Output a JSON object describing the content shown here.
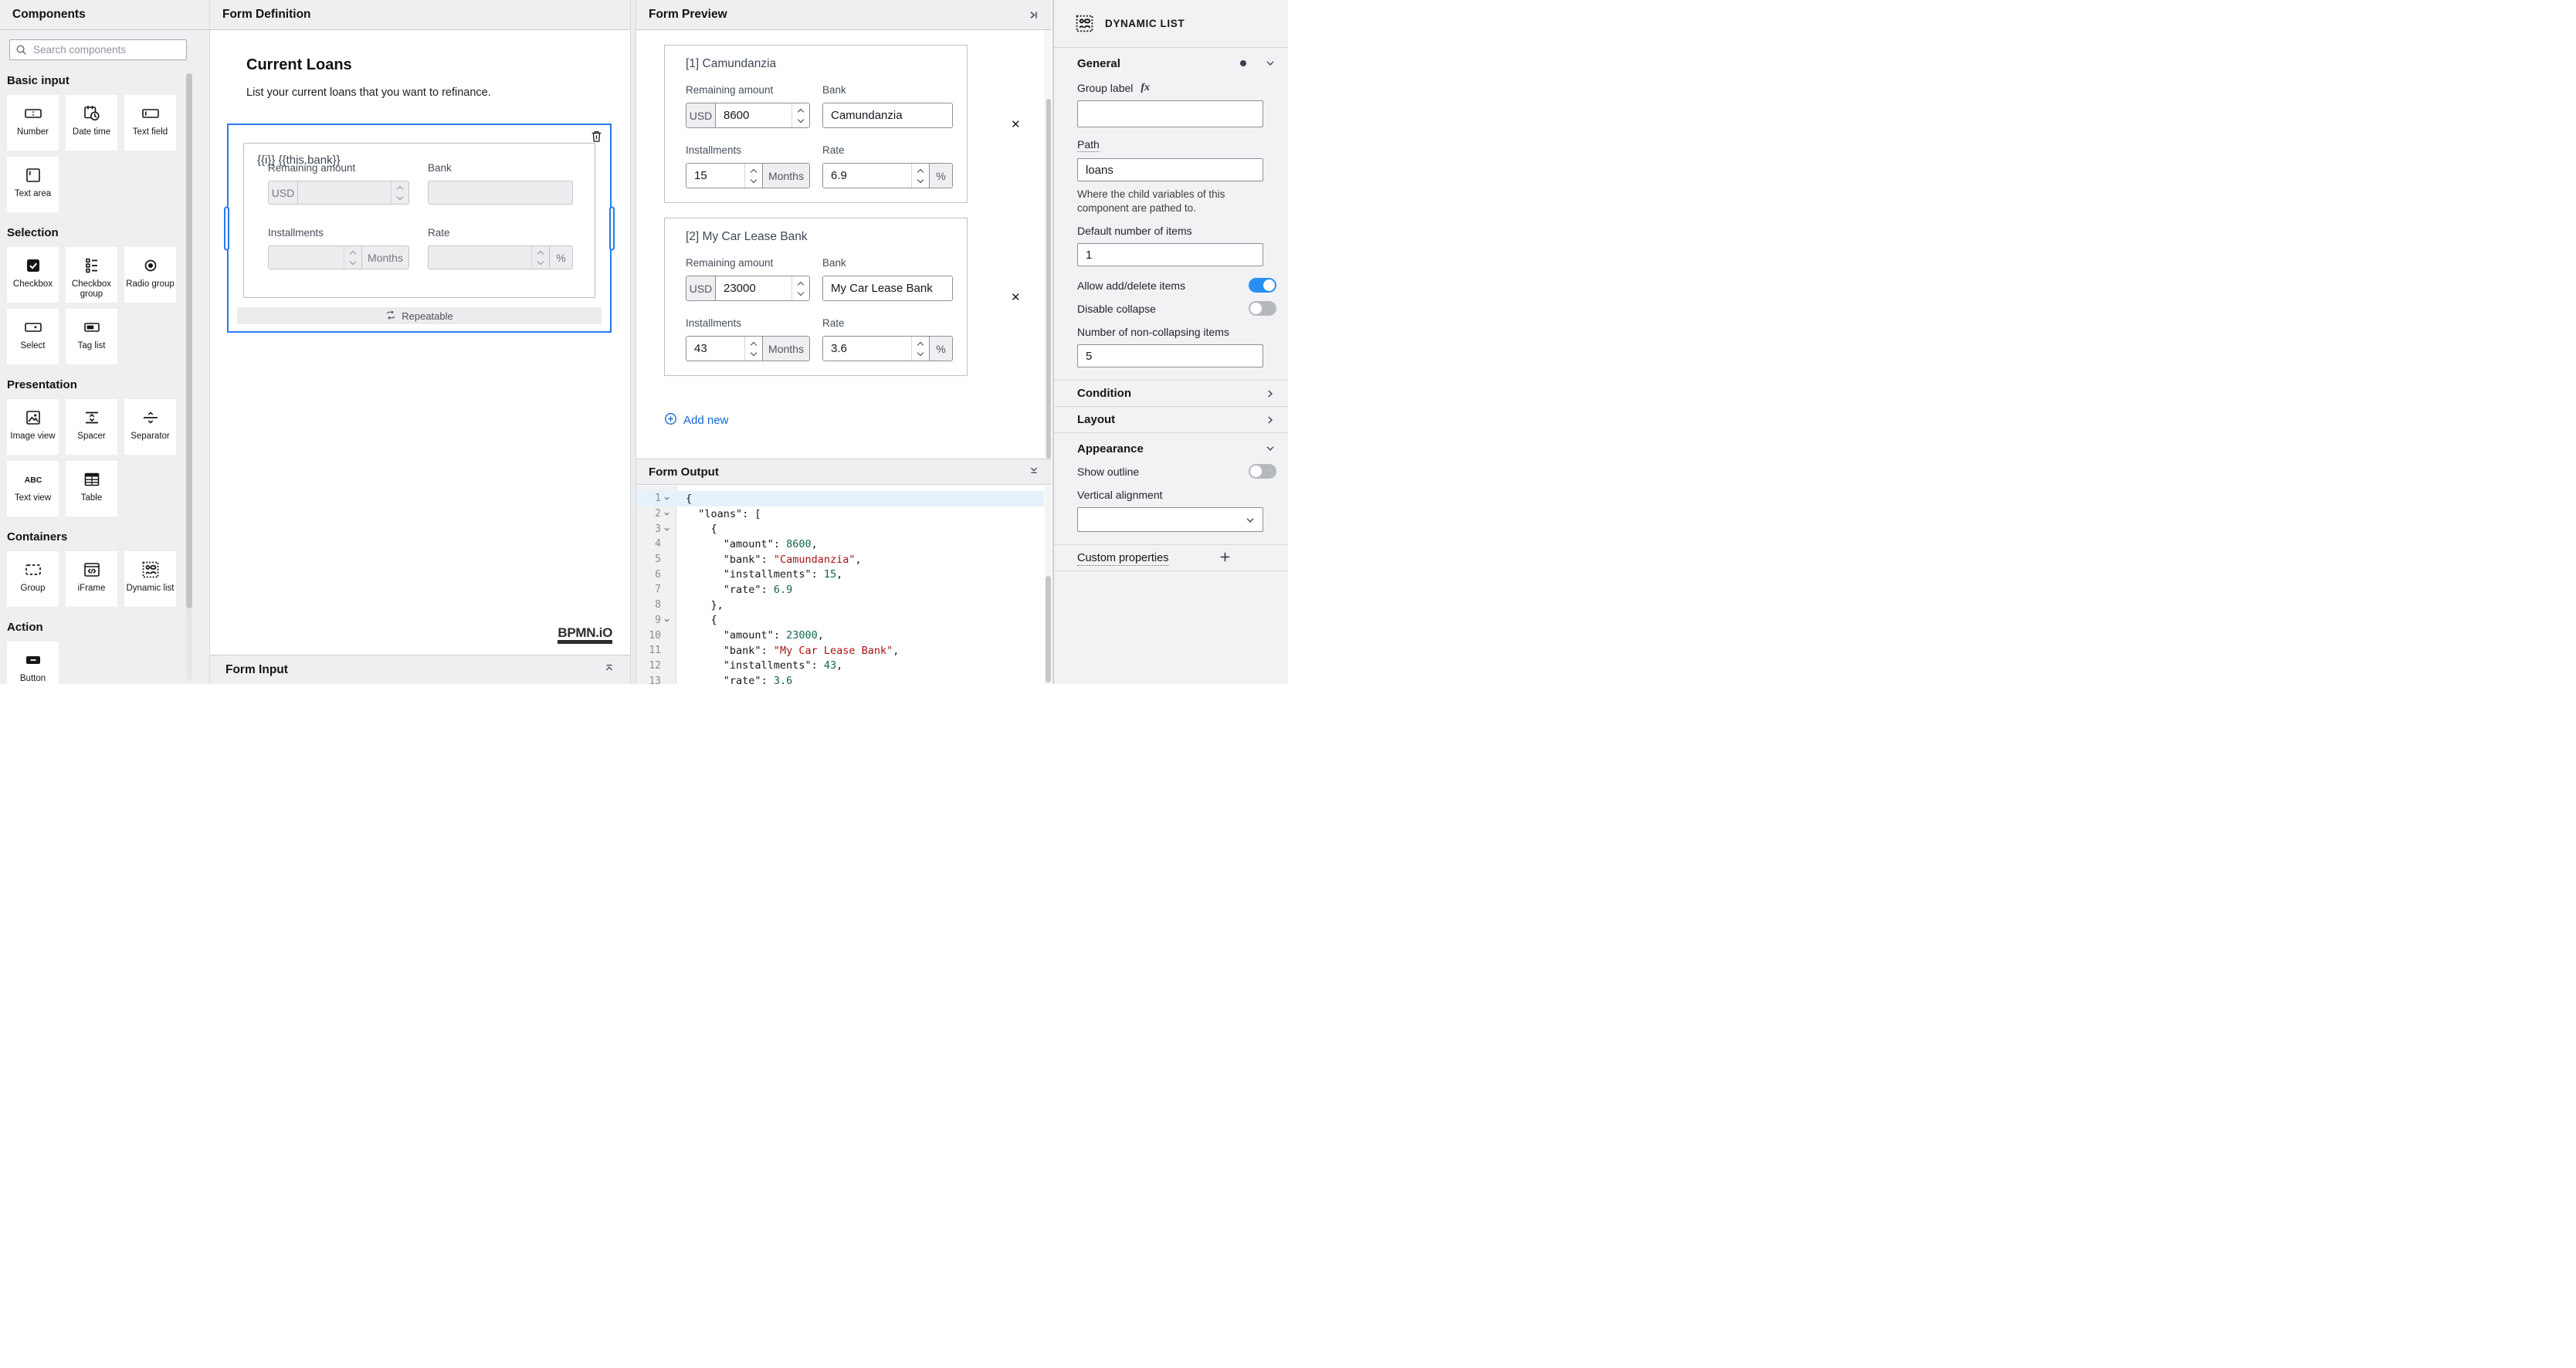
{
  "colors": {
    "accent_blue": "#2878f0",
    "link_blue": "#1266d3",
    "toggle_on_blue": "#2590f2",
    "code_string_red": "#aa1111",
    "code_number_green": "#11664d",
    "active_line_blue": "#e7f1fa"
  },
  "palette": {
    "title": "Components",
    "search": {
      "placeholder": "Search components",
      "icon": "search-icon"
    },
    "sections": [
      {
        "label": "Basic input",
        "items": [
          {
            "label": "Number",
            "icon": "number-icon"
          },
          {
            "label": "Date time",
            "icon": "datetime-icon"
          },
          {
            "label": "Text field",
            "icon": "textfield-icon"
          },
          {
            "label": "Text area",
            "icon": "textarea-icon"
          }
        ]
      },
      {
        "label": "Selection",
        "items": [
          {
            "label": "Checkbox",
            "icon": "checkbox-icon"
          },
          {
            "label": "Checkbox group",
            "icon": "checkbox-group-icon"
          },
          {
            "label": "Radio group",
            "icon": "radio-group-icon"
          },
          {
            "label": "Select",
            "icon": "select-icon"
          },
          {
            "label": "Tag list",
            "icon": "tag-list-icon"
          }
        ]
      },
      {
        "label": "Presentation",
        "items": [
          {
            "label": "Image view",
            "icon": "image-view-icon"
          },
          {
            "label": "Spacer",
            "icon": "spacer-icon"
          },
          {
            "label": "Separator",
            "icon": "separator-icon"
          },
          {
            "label": "Text view",
            "icon": "text-view-icon"
          },
          {
            "label": "Table",
            "icon": "table-icon"
          }
        ]
      },
      {
        "label": "Containers",
        "items": [
          {
            "label": "Group",
            "icon": "group-icon"
          },
          {
            "label": "iFrame",
            "icon": "iframe-icon"
          },
          {
            "label": "Dynamic list",
            "icon": "dynamic-list-icon"
          }
        ]
      },
      {
        "label": "Action",
        "items": [
          {
            "label": "Button",
            "icon": "button-icon"
          }
        ]
      }
    ]
  },
  "definition": {
    "title": "Form Definition",
    "heading": "Current Loans",
    "description": "List your current loans that you want to refinance.",
    "component": {
      "title": "{{i}} {{this.bank}}",
      "repeatable_label": "Repeatable",
      "fields": [
        {
          "key": "amount",
          "label": "Remaining amount",
          "prefix": "USD",
          "spinner": true
        },
        {
          "key": "bank",
          "label": "Bank"
        },
        {
          "key": "installments",
          "label": "Installments",
          "spinner": true,
          "suffix": "Months"
        },
        {
          "key": "rate",
          "label": "Rate",
          "spinner": true,
          "suffix": "%"
        }
      ]
    },
    "watermark": "BPMN.iO",
    "input_panel": {
      "title": "Form Input"
    }
  },
  "preview": {
    "title": "Form Preview",
    "labels": {
      "amount": "Remaining amount",
      "bank": "Bank",
      "installments": "Installments",
      "rate": "Rate"
    },
    "units": {
      "currency": "USD",
      "months": "Months",
      "percent": "%"
    },
    "cards": [
      {
        "title": "[1] Camundanzia",
        "amount": "8600",
        "bank": "Camundanzia",
        "installments": "15",
        "rate": "6.9"
      },
      {
        "title": "[2] My Car Lease Bank",
        "amount": "23000",
        "bank": "My Car Lease Bank",
        "installments": "43",
        "rate": "3.6"
      }
    ],
    "add_new_label": "Add new"
  },
  "output": {
    "title": "Form Output",
    "lines": [
      {
        "n": 1,
        "fold": true,
        "active": true,
        "t": [
          [
            "p",
            "{"
          ]
        ]
      },
      {
        "n": 2,
        "fold": true,
        "t": [
          [
            "p",
            "  "
          ],
          [
            "k",
            "\"loans\""
          ],
          [
            "p",
            ": ["
          ]
        ]
      },
      {
        "n": 3,
        "fold": true,
        "t": [
          [
            "p",
            "    {"
          ]
        ]
      },
      {
        "n": 4,
        "t": [
          [
            "p",
            "      "
          ],
          [
            "k",
            "\"amount\""
          ],
          [
            "p",
            ": "
          ],
          [
            "num",
            "8600"
          ],
          [
            "p",
            ","
          ]
        ]
      },
      {
        "n": 5,
        "t": [
          [
            "p",
            "      "
          ],
          [
            "k",
            "\"bank\""
          ],
          [
            "p",
            ": "
          ],
          [
            "str",
            "\"Camundanzia\""
          ],
          [
            "p",
            ","
          ]
        ]
      },
      {
        "n": 6,
        "t": [
          [
            "p",
            "      "
          ],
          [
            "k",
            "\"installments\""
          ],
          [
            "p",
            ": "
          ],
          [
            "num",
            "15"
          ],
          [
            "p",
            ","
          ]
        ]
      },
      {
        "n": 7,
        "t": [
          [
            "p",
            "      "
          ],
          [
            "k",
            "\"rate\""
          ],
          [
            "p",
            ": "
          ],
          [
            "num",
            "6.9"
          ]
        ]
      },
      {
        "n": 8,
        "t": [
          [
            "p",
            "    },"
          ]
        ]
      },
      {
        "n": 9,
        "fold": true,
        "t": [
          [
            "p",
            "    {"
          ]
        ]
      },
      {
        "n": 10,
        "t": [
          [
            "p",
            "      "
          ],
          [
            "k",
            "\"amount\""
          ],
          [
            "p",
            ": "
          ],
          [
            "num",
            "23000"
          ],
          [
            "p",
            ","
          ]
        ]
      },
      {
        "n": 11,
        "t": [
          [
            "p",
            "      "
          ],
          [
            "k",
            "\"bank\""
          ],
          [
            "p",
            ": "
          ],
          [
            "str",
            "\"My Car Lease Bank\""
          ],
          [
            "p",
            ","
          ]
        ]
      },
      {
        "n": 12,
        "t": [
          [
            "p",
            "      "
          ],
          [
            "k",
            "\"installments\""
          ],
          [
            "p",
            ": "
          ],
          [
            "num",
            "43"
          ],
          [
            "p",
            ","
          ]
        ]
      },
      {
        "n": 13,
        "t": [
          [
            "p",
            "      "
          ],
          [
            "k",
            "\"rate\""
          ],
          [
            "p",
            ": "
          ],
          [
            "num",
            "3.6"
          ]
        ]
      }
    ]
  },
  "properties": {
    "header": {
      "title": "DYNAMIC LIST",
      "icon": "dynamic-list-icon"
    },
    "general": {
      "title": "General",
      "group_label": {
        "label": "Group label",
        "value": "",
        "has_fx": true
      },
      "path": {
        "label": "Path",
        "value": "loans",
        "help": "Where the child variables of this component are pathed to."
      },
      "default_items": {
        "label": "Default number of items",
        "value": "1"
      },
      "allow_add_delete": {
        "label": "Allow add/delete items",
        "on": true
      },
      "disable_collapse": {
        "label": "Disable collapse",
        "on": false
      },
      "non_collapsing": {
        "label": "Number of non-collapsing items",
        "value": "5"
      }
    },
    "condition": {
      "title": "Condition"
    },
    "layout": {
      "title": "Layout"
    },
    "appearance": {
      "title": "Appearance",
      "show_outline": {
        "label": "Show outline",
        "on": false
      },
      "vertical_alignment": {
        "label": "Vertical alignment",
        "value": ""
      }
    },
    "custom_properties": {
      "title": "Custom properties"
    }
  }
}
